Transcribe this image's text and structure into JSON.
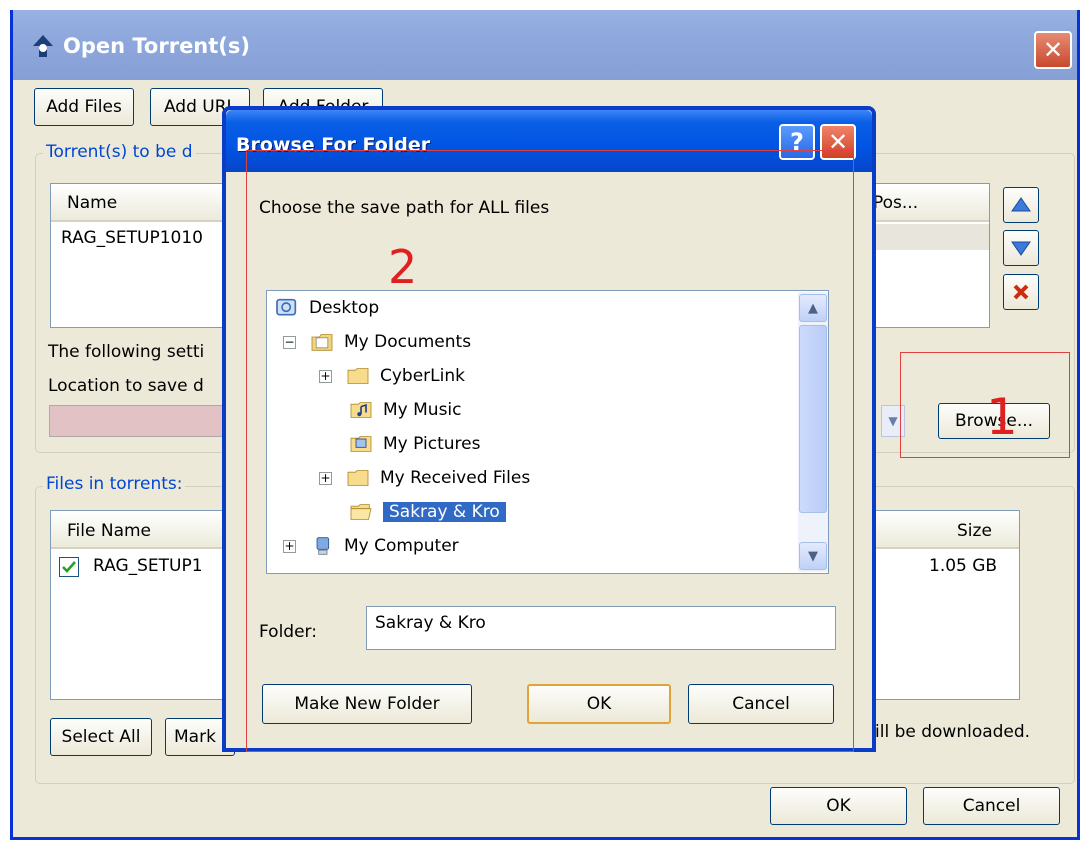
{
  "outer": {
    "title": "Open Torrent(s)",
    "close": "✕",
    "buttons": {
      "add_files": "Add Files",
      "add_url": "Add URL",
      "add_folder": "Add Folder"
    },
    "torrents_group_label": "Torrent(s) to be d",
    "torrents_columns": {
      "name": "Name",
      "pos": "Pos..."
    },
    "torrents_rows": [
      "RAG_SETUP1010"
    ],
    "settings_text": "The following setti",
    "location_label": "Location to save d",
    "browse_button": "Browse...",
    "files_group_label": "Files in torrents:",
    "files_columns": {
      "file_name": "File Name",
      "size": "Size"
    },
    "files_rows": [
      {
        "name": "RAG_SETUP1",
        "size": "1.05 GB",
        "checked": true
      }
    ],
    "select_all": "Select All",
    "mark": "Mark",
    "download_note": "ill be downloaded.",
    "ok": "OK",
    "cancel": "Cancel"
  },
  "dialog": {
    "title": "Browse For Folder",
    "help": "?",
    "close": "✕",
    "instruction": "Choose the save path for ALL files",
    "tree": [
      {
        "label": "Desktop",
        "icon": "desktop-icon"
      },
      {
        "label": "My Documents",
        "icon": "my-documents-icon"
      },
      {
        "label": "CyberLink",
        "icon": "folder-icon"
      },
      {
        "label": "My Music",
        "icon": "my-music-icon"
      },
      {
        "label": "My Pictures",
        "icon": "my-pictures-icon"
      },
      {
        "label": "My Received Files",
        "icon": "folder-icon"
      },
      {
        "label": "Sakray & Kro",
        "icon": "folder-open-icon",
        "selected": true
      },
      {
        "label": "My Computer",
        "icon": "my-computer-icon"
      }
    ],
    "expanders": {
      "minus": "−",
      "plus": "+"
    },
    "folder_label": "Folder:",
    "folder_value": "Sakray & Kro",
    "make_new_folder": "Make New Folder",
    "ok": "OK",
    "cancel": "Cancel"
  },
  "annotations": {
    "one": "1",
    "two": "2",
    "color": "#e02020"
  },
  "colors": {
    "xp_blue": "#0054e3",
    "selection": "#316ac5",
    "face": "#ece9d8"
  }
}
